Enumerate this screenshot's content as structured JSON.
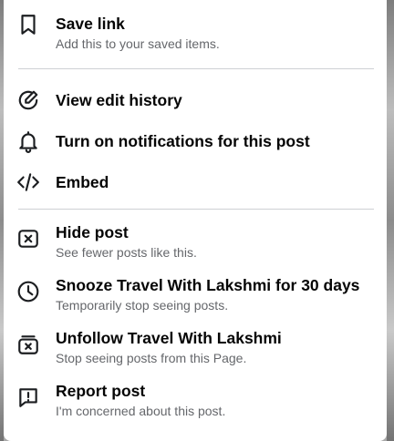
{
  "menu": {
    "save": {
      "title": "Save link",
      "subtitle": "Add this to your saved items."
    },
    "edit_history": {
      "title": "View edit history"
    },
    "notifications": {
      "title": "Turn on notifications for this post"
    },
    "embed": {
      "title": "Embed"
    },
    "hide": {
      "title": "Hide post",
      "subtitle": "See fewer posts like this."
    },
    "snooze": {
      "title": "Snooze Travel With Lakshmi for 30 days",
      "subtitle": "Temporarily stop seeing posts."
    },
    "unfollow": {
      "title": "Unfollow Travel With Lakshmi",
      "subtitle": "Stop seeing posts from this Page."
    },
    "report": {
      "title": "Report post",
      "subtitle": "I'm concerned about this post."
    }
  },
  "icons": {
    "save": "bookmark-icon",
    "edit_history": "edit-history-icon",
    "notifications": "bell-icon",
    "embed": "code-icon",
    "hide": "hide-x-box-icon",
    "snooze": "clock-icon",
    "unfollow": "unfollow-icon",
    "report": "report-flag-icon"
  }
}
